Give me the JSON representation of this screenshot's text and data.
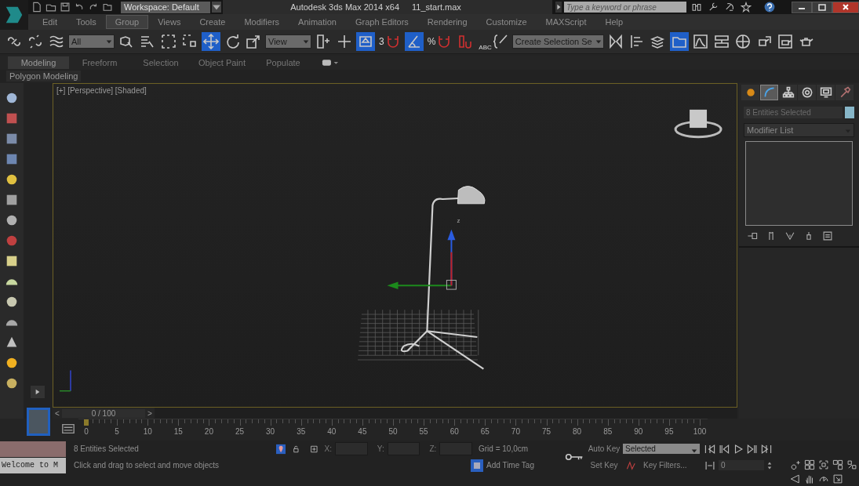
{
  "title_bar": {
    "workspace": "Workspace: Default",
    "title": "Autodesk 3ds Max  2014 x64",
    "file": "11_start.max",
    "search": {
      "placeholder": "Type a keyword or phrase"
    }
  },
  "menu": [
    {
      "label": "Edit",
      "hovered": false
    },
    {
      "label": "Tools",
      "hovered": false
    },
    {
      "label": "Group",
      "hovered": true
    },
    {
      "label": "Views",
      "hovered": false
    },
    {
      "label": "Create",
      "hovered": false
    },
    {
      "label": "Modifiers",
      "hovered": false
    },
    {
      "label": "Animation",
      "hovered": false
    },
    {
      "label": "Graph Editors",
      "hovered": false
    },
    {
      "label": "Rendering",
      "hovered": false
    },
    {
      "label": "Customize",
      "hovered": false
    },
    {
      "label": "MAXScript",
      "hovered": false
    },
    {
      "label": "Help",
      "hovered": false
    }
  ],
  "toolbar": {
    "items": [
      {
        "kind": "link",
        "active": false
      },
      {
        "kind": "unlink",
        "active": false
      },
      {
        "kind": "bind",
        "active": false
      },
      {
        "kind": "dropdown",
        "value": "All"
      },
      {
        "kind": "select-object",
        "active": false
      },
      {
        "kind": "select-by-name",
        "active": false
      },
      {
        "kind": "rect-region",
        "active": false
      },
      {
        "kind": "window-crossing",
        "active": false
      },
      {
        "kind": "move",
        "active": true
      },
      {
        "kind": "rotate",
        "active": false
      },
      {
        "kind": "scale",
        "active": false
      },
      {
        "kind": "dropdown",
        "value": "View"
      },
      {
        "kind": "pivot",
        "active": false
      },
      {
        "kind": "manipulate",
        "active": false
      },
      {
        "kind": "keyboard",
        "active": true
      },
      {
        "kind": "snap",
        "label": "3",
        "active": false
      },
      {
        "kind": "angle-snap",
        "active": true
      },
      {
        "kind": "snap",
        "label": "%",
        "active": false
      },
      {
        "kind": "spinner-snap",
        "active": false
      },
      {
        "kind": "named-sets",
        "label": "ABC",
        "active": false
      },
      {
        "kind": "dropdown",
        "value": "Create Selection Se"
      },
      {
        "kind": "mirror",
        "active": false
      },
      {
        "kind": "align",
        "active": false
      },
      {
        "kind": "layers",
        "active": false
      },
      {
        "kind": "scene-explorer",
        "active": true
      },
      {
        "kind": "curve-editor",
        "active": false
      },
      {
        "kind": "schematic",
        "active": false
      },
      {
        "kind": "material-editor",
        "active": false
      },
      {
        "kind": "render-setup",
        "active": false
      },
      {
        "kind": "rendered-frame",
        "active": false
      },
      {
        "kind": "render",
        "active": false
      }
    ]
  },
  "ribbon": {
    "tabs": [
      {
        "label": "Modeling",
        "selected": true
      },
      {
        "label": "Freeform",
        "selected": false
      },
      {
        "label": "Selection",
        "selected": false
      },
      {
        "label": "Object Paint",
        "selected": false
      },
      {
        "label": "Populate",
        "selected": false
      }
    ],
    "panel": "Polygon Modeling"
  },
  "viewport": {
    "label": "[+] [Perspective] [Shaded]",
    "gizmo_axis": "z"
  },
  "command_panel": {
    "tabs": [
      {
        "kind": "create",
        "selected": false
      },
      {
        "kind": "modify",
        "selected": true
      },
      {
        "kind": "hierarchy",
        "selected": false
      },
      {
        "kind": "motion",
        "selected": false
      },
      {
        "kind": "display",
        "selected": false
      },
      {
        "kind": "utilities",
        "selected": false
      }
    ],
    "name": "8 Entities Selected",
    "modifier_list": "Modifier List"
  },
  "time_slider": {
    "prev": "<",
    "frame": "0 / 100",
    "next": ">",
    "level": 0
  },
  "track_bar": {
    "ticks": [
      "0",
      "5",
      "10",
      "15",
      "20",
      "25",
      "30",
      "35",
      "40",
      "45",
      "50",
      "55",
      "60",
      "65",
      "70",
      "75",
      "80",
      "85",
      "90",
      "95",
      "100"
    ]
  },
  "status": {
    "listener": "Welcome to M",
    "selection": "8 Entities Selected",
    "prompt": "Click and drag to select and move objects",
    "x_label": "X:",
    "y_label": "Y:",
    "z_label": "Z:",
    "grid": "Grid = 10,0cm",
    "add_time_tag": "Add Time Tag",
    "auto_key": "Auto Key",
    "key_mode": "Selected",
    "set_key": "Set Key",
    "key_filters": "Key Filters...",
    "frame": "0"
  }
}
